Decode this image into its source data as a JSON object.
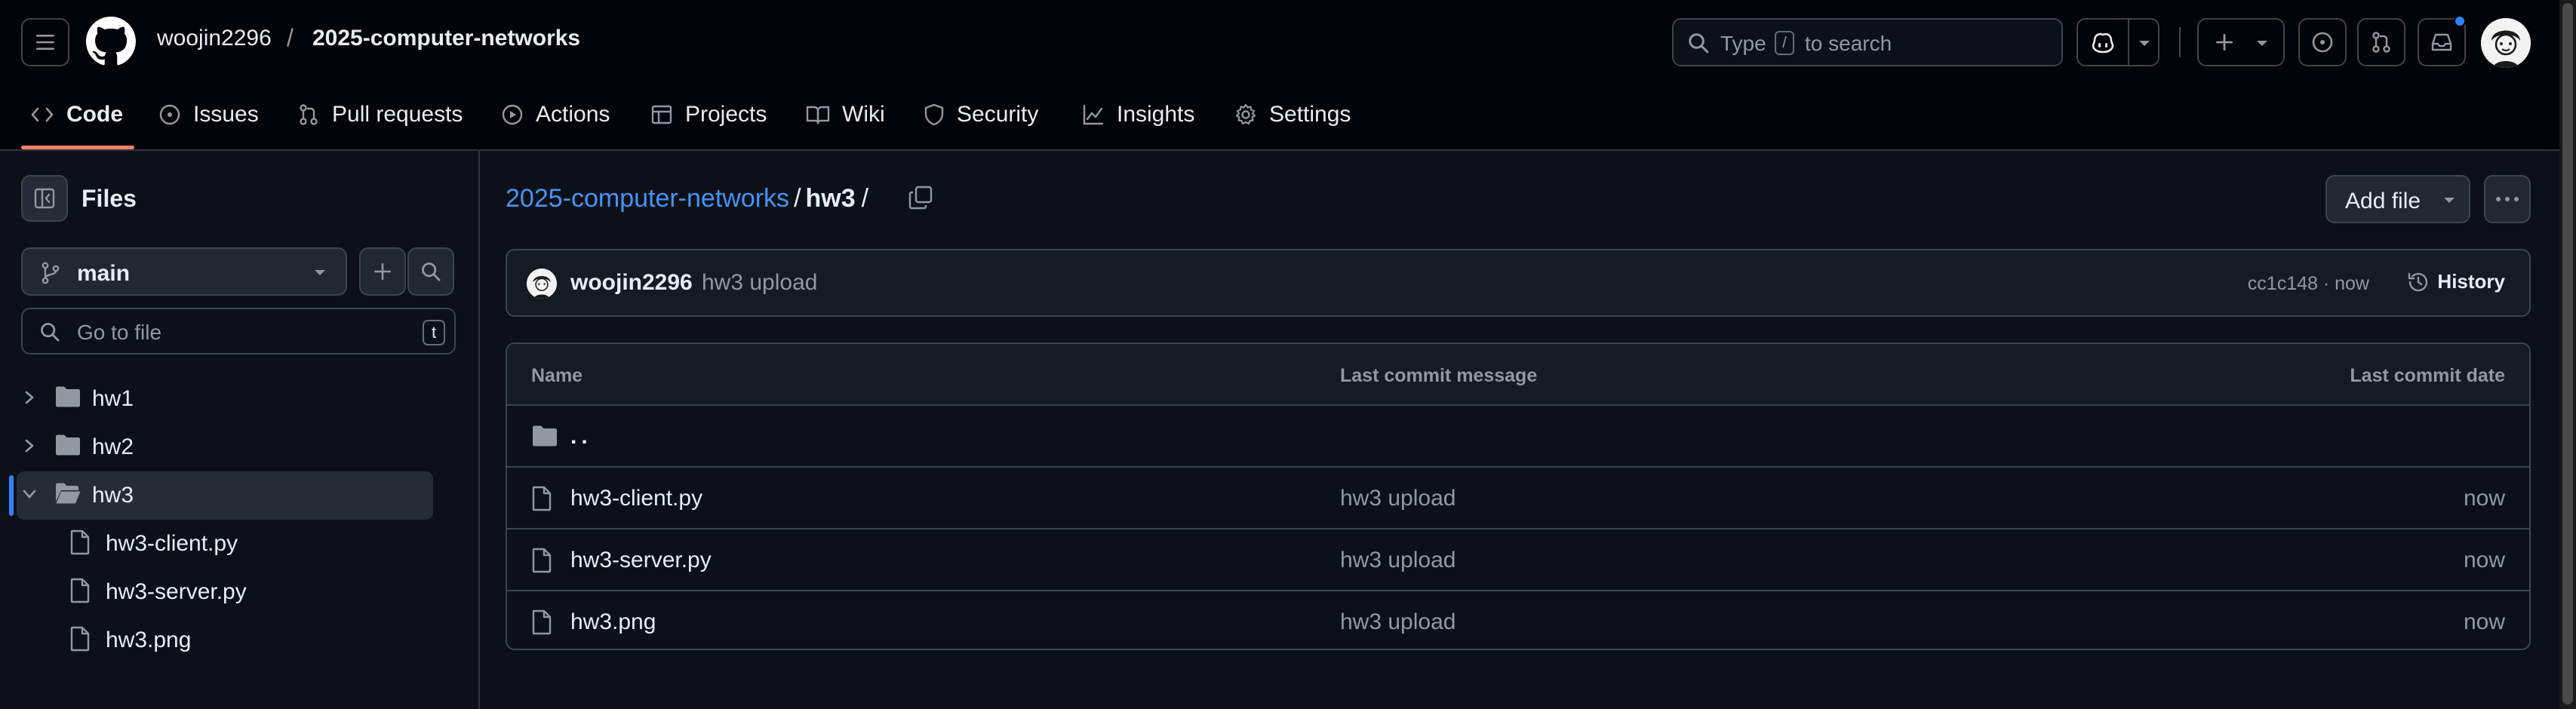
{
  "header": {
    "owner": "woojin2296",
    "separator": "/",
    "repo": "2025-computer-networks",
    "search": {
      "prefix": "Type",
      "key": "/",
      "suffix": "to search"
    }
  },
  "repo_nav": {
    "tabs": [
      {
        "label": "Code",
        "icon": "code-icon",
        "active": true
      },
      {
        "label": "Issues",
        "icon": "issue-icon"
      },
      {
        "label": "Pull requests",
        "icon": "pull-request-icon"
      },
      {
        "label": "Actions",
        "icon": "play-icon"
      },
      {
        "label": "Projects",
        "icon": "table-icon"
      },
      {
        "label": "Wiki",
        "icon": "book-icon"
      },
      {
        "label": "Security",
        "icon": "shield-icon"
      },
      {
        "label": "Insights",
        "icon": "graph-icon"
      },
      {
        "label": "Settings",
        "icon": "gear-icon"
      }
    ]
  },
  "sidebar": {
    "title": "Files",
    "branch": "main",
    "goto_placeholder": "Go to file",
    "goto_key": "t",
    "tree": [
      {
        "type": "folder",
        "name": "hw1",
        "expanded": false
      },
      {
        "type": "folder",
        "name": "hw2",
        "expanded": false
      },
      {
        "type": "folder",
        "name": "hw3",
        "expanded": true,
        "selected": true
      },
      {
        "type": "file",
        "name": "hw3-client.py"
      },
      {
        "type": "file",
        "name": "hw3-server.py"
      },
      {
        "type": "file",
        "name": "hw3.png"
      }
    ]
  },
  "main": {
    "breadcrumb": {
      "repo": "2025-computer-networks",
      "sep": "/",
      "dir": "hw3",
      "trail": "/"
    },
    "add_file_label": "Add file",
    "commit": {
      "author": "woojin2296",
      "message": "hw3 upload",
      "sha_time": "cc1c148 · now",
      "history_label": "History"
    },
    "table": {
      "headers": {
        "name": "Name",
        "message": "Last commit message",
        "date": "Last commit date"
      },
      "parent": "..",
      "rows": [
        {
          "name": "hw3-client.py",
          "message": "hw3 upload",
          "date": "now"
        },
        {
          "name": "hw3-server.py",
          "message": "hw3 upload",
          "date": "now"
        },
        {
          "name": "hw3.png",
          "message": "hw3 upload",
          "date": "now"
        }
      ]
    }
  },
  "colors": {
    "background": "#0d1117",
    "header": "#010409",
    "border": "#3d444d",
    "link": "#4493f8",
    "accent_underline": "#f78166",
    "selected_bar": "#2f81f7",
    "muted_text": "#9198a1"
  }
}
